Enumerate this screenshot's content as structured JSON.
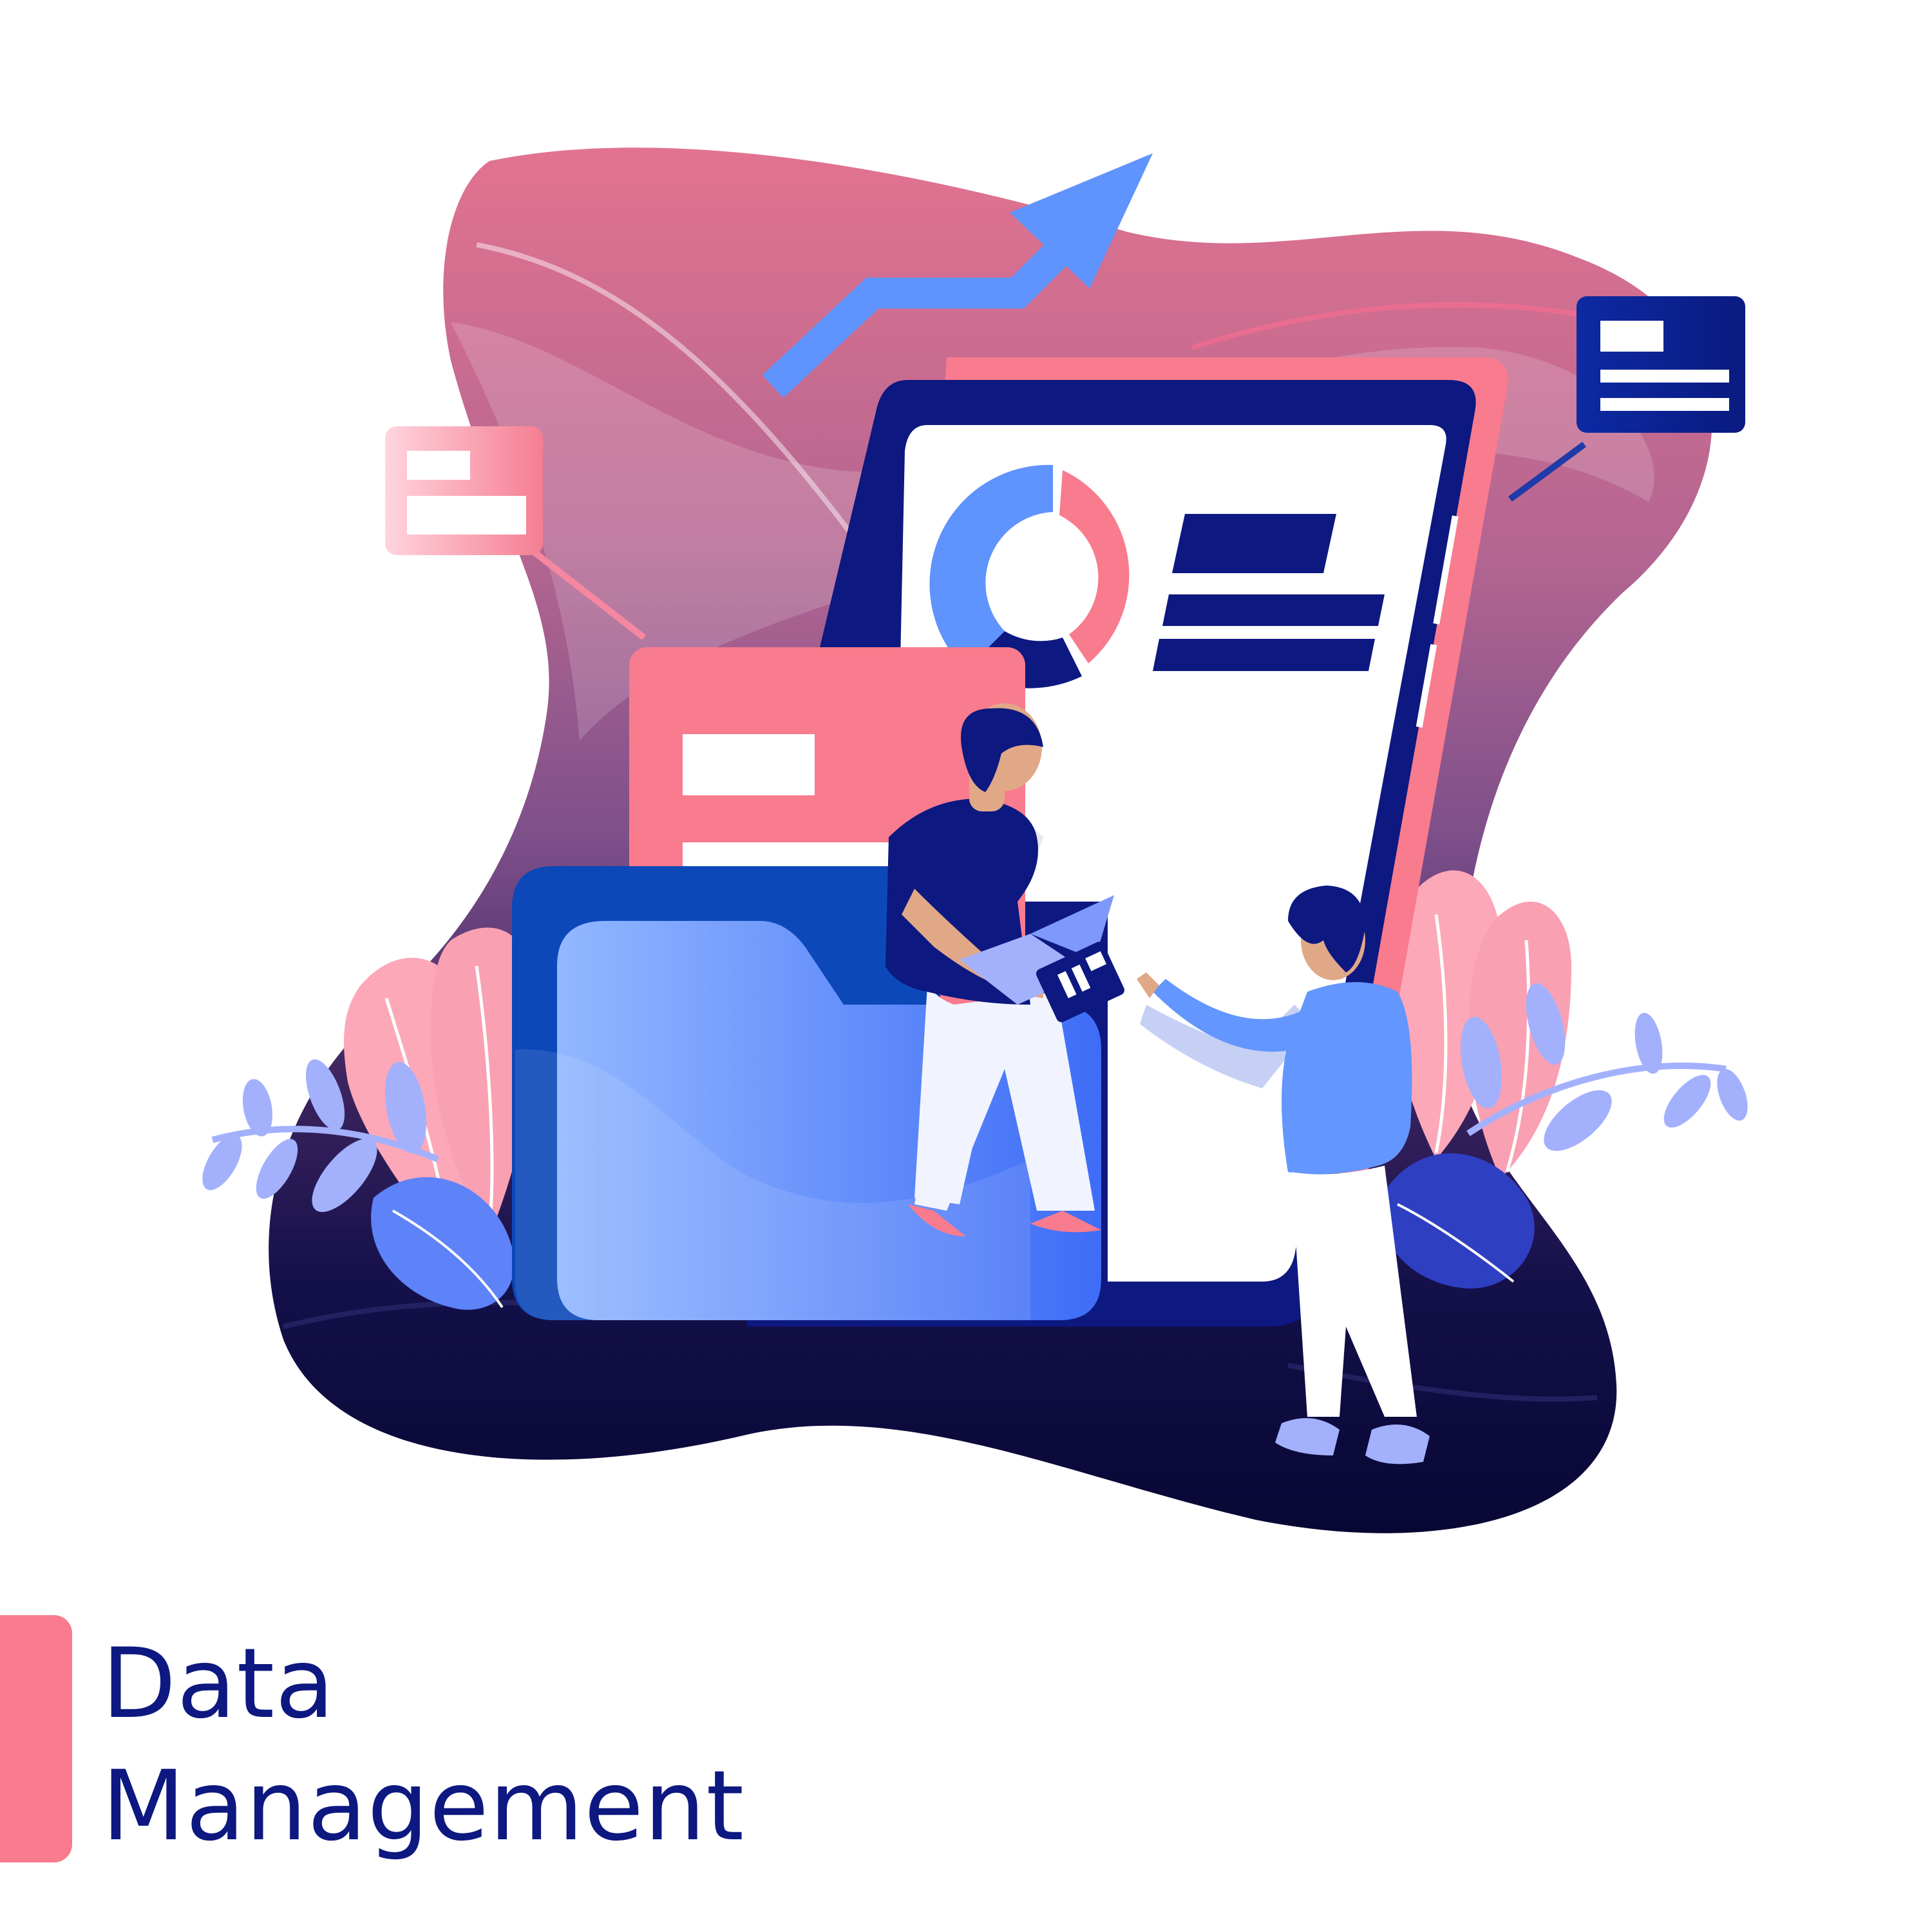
{
  "title": {
    "line1": "Data",
    "line2": "Management"
  },
  "colors": {
    "accent_pink": "#F87B8E",
    "navy": "#0D1880",
    "navy_dark": "#061357",
    "blue": "#6396FE",
    "blob_top": "#E27390",
    "blob_mid": "#8C5B9A",
    "blob_bottom": "#0B0838",
    "leaf_light_blue": "#A3B1FD",
    "leaf_pink": "#FCA8B8",
    "skin": "#E0A887",
    "white": "#FFFFFF"
  },
  "icons": [
    "growth-arrow-icon",
    "donut-chart-icon",
    "document-card-icon",
    "folder-icon",
    "id-card-icon",
    "laptop-icon",
    "leaf-icon"
  ]
}
